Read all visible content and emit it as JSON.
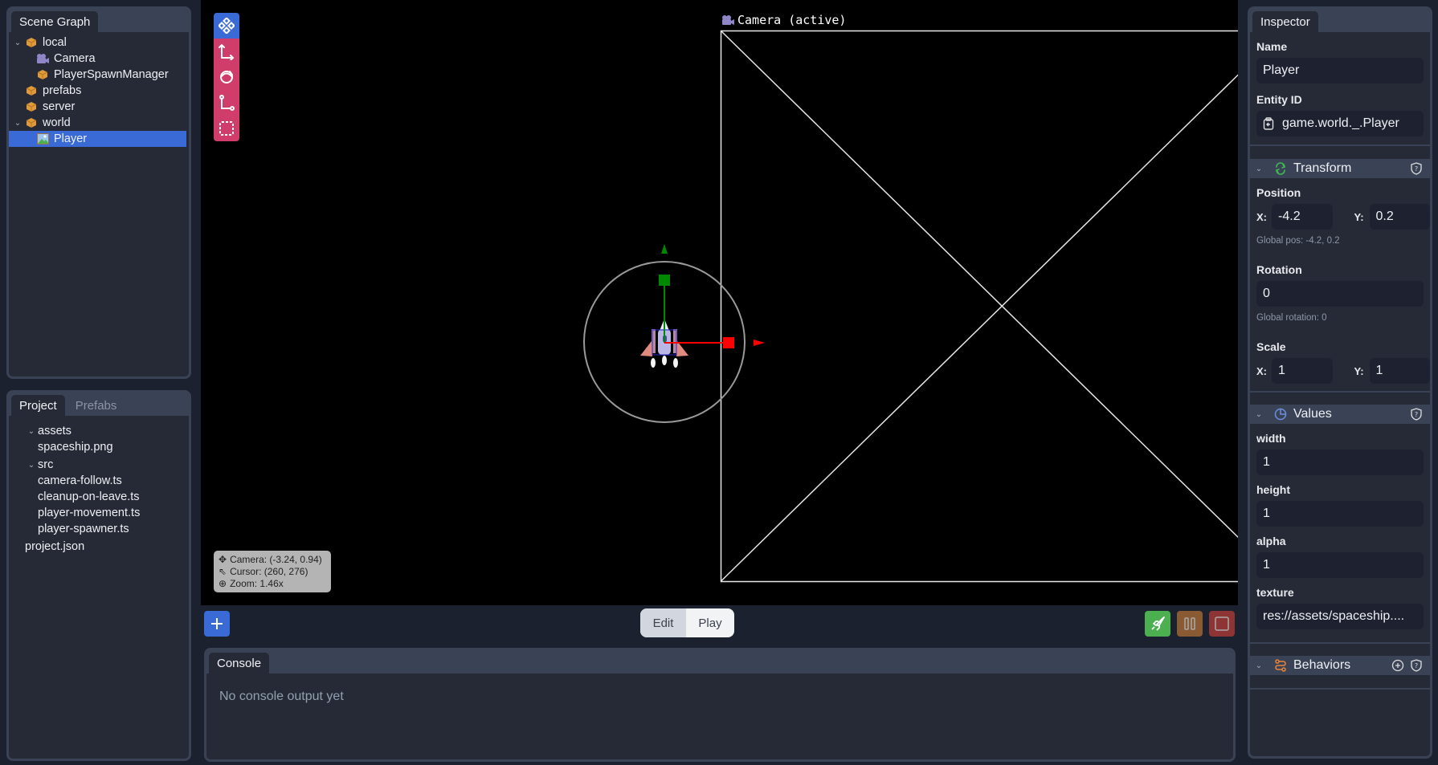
{
  "scene_graph": {
    "tab": "Scene Graph",
    "items": [
      {
        "label": "local",
        "icon": "package-icon",
        "expanded": true,
        "depth": 0
      },
      {
        "label": "Camera",
        "icon": "camera-icon",
        "depth": 1
      },
      {
        "label": "PlayerSpawnManager",
        "icon": "package-icon",
        "depth": 1
      },
      {
        "label": "prefabs",
        "icon": "package-icon",
        "depth": 0
      },
      {
        "label": "server",
        "icon": "package-icon",
        "depth": 0
      },
      {
        "label": "world",
        "icon": "package-icon",
        "expanded": true,
        "depth": 0
      },
      {
        "label": "Player",
        "icon": "image-icon",
        "depth": 1,
        "selected": true
      }
    ]
  },
  "project": {
    "tabs": [
      "Project",
      "Prefabs"
    ],
    "active_tab": "Project",
    "items": [
      {
        "label": "assets",
        "folder": true
      },
      {
        "label": "spaceship.png",
        "folder": false
      },
      {
        "label": "src",
        "folder": true
      },
      {
        "label": "camera-follow.ts",
        "folder": false
      },
      {
        "label": "cleanup-on-leave.ts",
        "folder": false
      },
      {
        "label": "player-movement.ts",
        "folder": false
      },
      {
        "label": "player-spawner.ts",
        "folder": false
      },
      {
        "label": "project.json",
        "folder": false
      }
    ]
  },
  "viewport": {
    "tools": [
      "move-all-tool",
      "translate-tool",
      "rotate-tool",
      "scale-tool",
      "select-rect-tool"
    ],
    "active_tool": "move-all-tool",
    "camera_label": "Camera (active)",
    "readout": {
      "camera": "Camera: (-3.24, 0.94)",
      "cursor": "Cursor: (260, 276)",
      "zoom": "Zoom: 1.46x"
    }
  },
  "toolbar": {
    "add_label": "+",
    "mode_edit": "Edit",
    "mode_play": "Play",
    "active_mode": "Edit",
    "colors": {
      "launch": "#4caf50",
      "pause": "#8a5a33",
      "stop": "#8e3434"
    }
  },
  "console": {
    "tab": "Console",
    "empty_text": "No console output yet"
  },
  "inspector": {
    "tab": "Inspector",
    "name_label": "Name",
    "name_value": "Player",
    "entity_id_label": "Entity ID",
    "entity_id_value": "game.world._.Player",
    "transform": {
      "title": "Transform",
      "position_label": "Position",
      "pos_x": "-4.2",
      "pos_y": "0.2",
      "global_pos": "Global pos: -4.2, 0.2",
      "rotation_label": "Rotation",
      "rotation": "0",
      "global_rotation": "Global rotation: 0",
      "scale_label": "Scale",
      "scale_x": "1",
      "scale_y": "1",
      "x_label": "X:",
      "y_label": "Y:"
    },
    "values": {
      "title": "Values",
      "fields": [
        {
          "label": "width",
          "value": "1"
        },
        {
          "label": "height",
          "value": "1"
        },
        {
          "label": "alpha",
          "value": "1"
        },
        {
          "label": "texture",
          "value": "res://assets/spaceship...."
        }
      ]
    },
    "behaviors": {
      "title": "Behaviors"
    }
  }
}
